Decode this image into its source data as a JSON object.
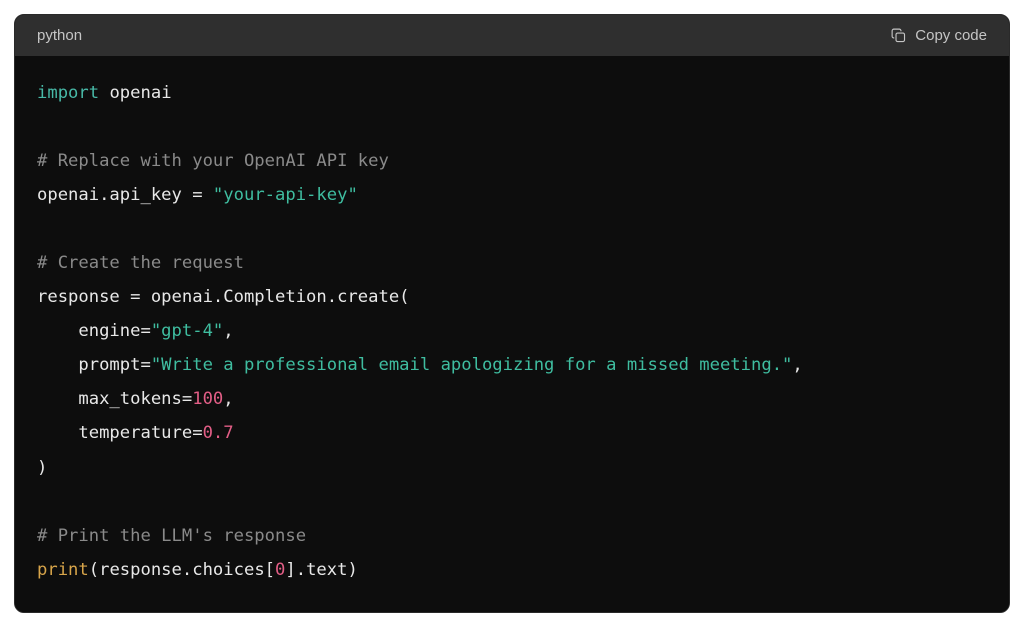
{
  "header": {
    "language": "python",
    "copy_label": "Copy code"
  },
  "code": {
    "lines": [
      [
        {
          "cls": "tok-keyword",
          "t": "import"
        },
        {
          "cls": "tok-default",
          "t": " "
        },
        {
          "cls": "tok-module",
          "t": "openai"
        }
      ],
      [],
      [
        {
          "cls": "tok-comment",
          "t": "# Replace with your OpenAI API key"
        }
      ],
      [
        {
          "cls": "tok-default",
          "t": "openai.api_key = "
        },
        {
          "cls": "tok-string",
          "t": "\"your-api-key\""
        }
      ],
      [],
      [
        {
          "cls": "tok-comment",
          "t": "# Create the request"
        }
      ],
      [
        {
          "cls": "tok-default",
          "t": "response = openai.Completion.create("
        }
      ],
      [
        {
          "cls": "tok-default",
          "t": "    engine="
        },
        {
          "cls": "tok-string",
          "t": "\"gpt-4\""
        },
        {
          "cls": "tok-default",
          "t": ","
        }
      ],
      [
        {
          "cls": "tok-default",
          "t": "    prompt="
        },
        {
          "cls": "tok-string",
          "t": "\"Write a professional email apologizing for a missed meeting.\""
        },
        {
          "cls": "tok-default",
          "t": ","
        }
      ],
      [
        {
          "cls": "tok-default",
          "t": "    max_tokens="
        },
        {
          "cls": "tok-number",
          "t": "100"
        },
        {
          "cls": "tok-default",
          "t": ","
        }
      ],
      [
        {
          "cls": "tok-default",
          "t": "    temperature="
        },
        {
          "cls": "tok-number",
          "t": "0.7"
        }
      ],
      [
        {
          "cls": "tok-default",
          "t": ")"
        }
      ],
      [],
      [
        {
          "cls": "tok-comment",
          "t": "# Print the LLM's response"
        }
      ],
      [
        {
          "cls": "tok-builtin",
          "t": "print"
        },
        {
          "cls": "tok-default",
          "t": "(response.choices["
        },
        {
          "cls": "tok-number",
          "t": "0"
        },
        {
          "cls": "tok-default",
          "t": "].text)"
        }
      ]
    ]
  }
}
